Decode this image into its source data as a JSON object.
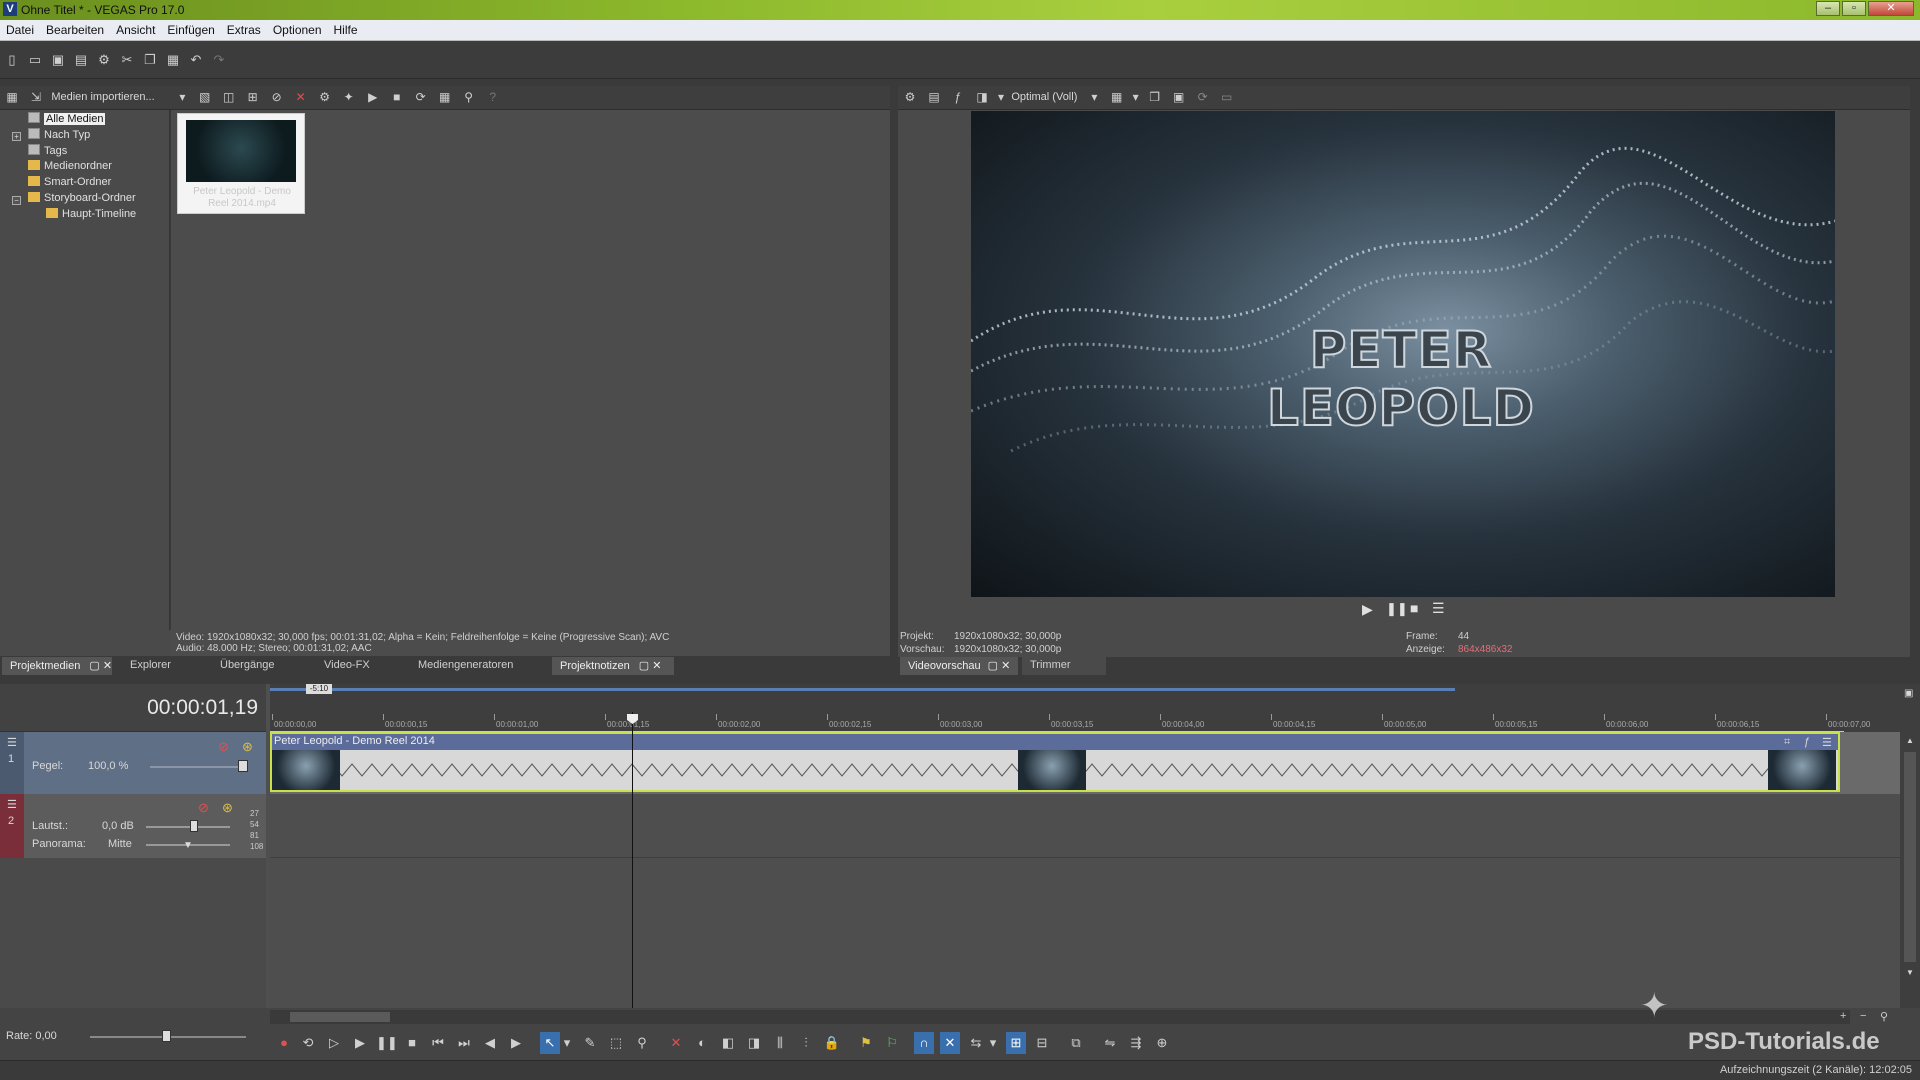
{
  "window": {
    "title": "Ohne Titel * - VEGAS Pro 17.0",
    "logo": "V",
    "min": "–",
    "max": "▫",
    "close": "✕"
  },
  "menu": [
    "Datei",
    "Bearbeiten",
    "Ansicht",
    "Einfügen",
    "Extras",
    "Optionen",
    "Hilfe"
  ],
  "media_toolbar": {
    "import_label": "Medien importieren..."
  },
  "media_tree": {
    "items": [
      {
        "label": "Alle Medien",
        "selected": true
      },
      {
        "label": "Nach Typ"
      },
      {
        "label": "Tags"
      },
      {
        "label": "Medienordner"
      },
      {
        "label": "Smart-Ordner"
      },
      {
        "label": "Storyboard-Ordner"
      },
      {
        "label": "Haupt-Timeline"
      }
    ]
  },
  "media_file": {
    "name": "Peter Leopold - Demo Reel 2014.mp4"
  },
  "media_info": {
    "video": "Video: 1920x1080x32; 30,000 fps; 00:01:31,02; Alpha = Kein; Feldreihenfolge = Keine (Progressive Scan); AVC",
    "audio": "Audio: 48.000 Hz; Stereo; 00:01:31,02; AAC"
  },
  "left_tabs": [
    "Projektmedien",
    "Explorer",
    "Übergänge",
    "Video-FX",
    "Mediengeneratoren",
    "Projektnotizen"
  ],
  "preview": {
    "quality": "Optimal (Voll)",
    "overlay_text": "PETER LEOPOLD",
    "projekt_label": "Projekt:",
    "projekt_value": "1920x1080x32; 30,000p",
    "vorschau_label": "Vorschau:",
    "vorschau_value": "1920x1080x32; 30,000p",
    "frame_label": "Frame:",
    "frame_value": "44",
    "anzeige_label": "Anzeige:",
    "anzeige_value": "864x486x32",
    "tabs": [
      "Videovorschau",
      "Trimmer"
    ]
  },
  "timeline": {
    "timecode": "00:00:01,19",
    "loop_marker": "-5:10",
    "ruler_labels": [
      "00:00:00,00",
      "00:00:00,15",
      "00:00:01,00",
      "00:00:01,15",
      "00:00:02,00",
      "00:00:02,15",
      "00:00:03,00",
      "00:00:03,15",
      "00:00:04,00",
      "00:00:04,15",
      "00:00:05,00",
      "00:00:05,15",
      "00:00:06,00",
      "00:00:06,15",
      "00:00:07,00"
    ],
    "track1": {
      "number": "1",
      "level_label": "Pegel:",
      "level_value": "100,0 %",
      "clip_name": "Peter Leopold - Demo Reel 2014"
    },
    "track2": {
      "number": "2",
      "volume_label": "Lautst.:",
      "volume_value": "0,0 dB",
      "pan_label": "Panorama:",
      "pan_value": "Mitte",
      "meter_labels": [
        "27",
        "54",
        "81",
        "108"
      ]
    },
    "rate_label": "Rate: 0,00"
  },
  "status": {
    "recording_time": "Aufzeichnungszeit (2 Kanäle): 12:02:05",
    "watermark": "PSD-Tutorials.de"
  },
  "colors": {
    "titlebar": "#8cb82c",
    "track_header": "#5f6f86",
    "clip": "#5b6b9a",
    "selection_yellow": "#c8e04a",
    "anzeige": "#e0707a"
  }
}
